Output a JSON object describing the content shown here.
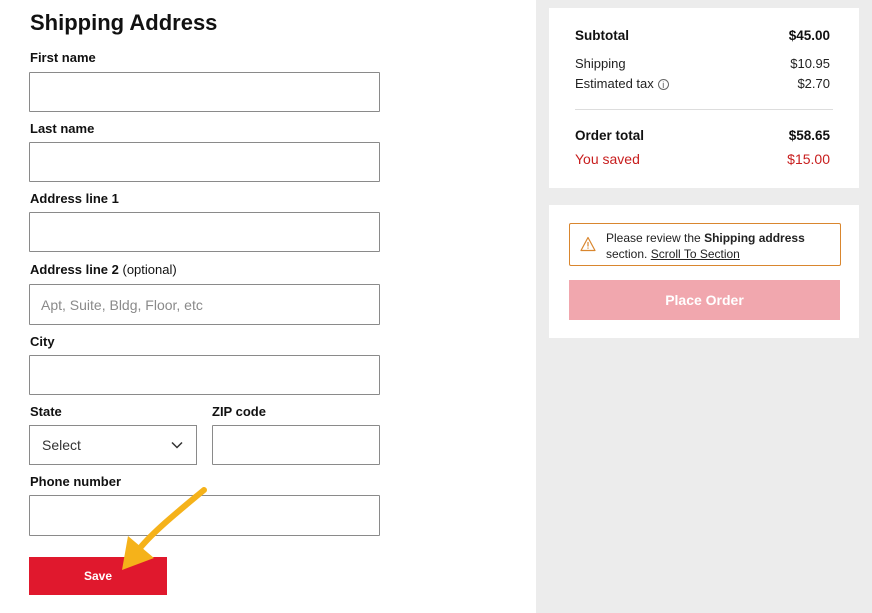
{
  "shipping": {
    "title": "Shipping Address",
    "first_name_label": "First name",
    "last_name_label": "Last name",
    "address1_label": "Address line 1",
    "address2_label": "Address line 2",
    "address2_optional": "(optional)",
    "address2_placeholder": "Apt, Suite, Bldg, Floor, etc",
    "city_label": "City",
    "state_label": "State",
    "state_value": "Select",
    "zip_label": "ZIP code",
    "phone_label": "Phone number",
    "save_label": "Save"
  },
  "summary": {
    "subtotal_label": "Subtotal",
    "subtotal_value": "$45.00",
    "shipping_label": "Shipping",
    "shipping_value": "$10.95",
    "tax_label": "Estimated tax",
    "tax_value": "$2.70",
    "total_label": "Order total",
    "total_value": "$58.65",
    "saved_label": "You saved",
    "saved_value": "$15.00"
  },
  "notice": {
    "text_before": "Please review the",
    "text_bold": "Shipping address",
    "text_after": "section.",
    "link": "Scroll To Section"
  },
  "place_order_label": "Place Order",
  "colors": {
    "save_button": "#e0182d",
    "place_order_disabled": "#f1a7ae",
    "saved_red": "#c81e1e",
    "notice_border": "#d9862e",
    "arrow": "#f5b21a"
  },
  "icons": [
    "info-icon",
    "warning-icon",
    "chevron-down-icon",
    "arrow-pointer-icon"
  ]
}
